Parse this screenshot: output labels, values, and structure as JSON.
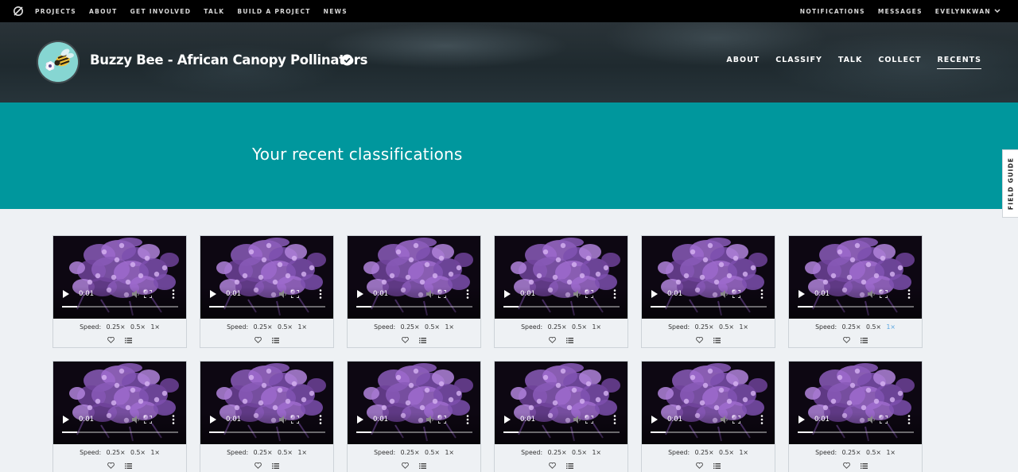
{
  "site_nav": {
    "left_items": [
      "PROJECTS",
      "ABOUT",
      "GET INVOLVED",
      "TALK",
      "BUILD A PROJECT",
      "NEWS"
    ],
    "right_items": [
      "NOTIFICATIONS",
      "MESSAGES"
    ],
    "user": "EVELYNKWAN",
    "logo_icon": "zooniverse-logo-icon"
  },
  "project": {
    "title": "Buzzy Bee - African Canopy Pollinators",
    "verified_icon": "verified-check-icon",
    "nav": [
      {
        "label": "ABOUT",
        "active": false
      },
      {
        "label": "CLASSIFY",
        "active": false
      },
      {
        "label": "TALK",
        "active": false
      },
      {
        "label": "COLLECT",
        "active": false
      },
      {
        "label": "RECENTS",
        "active": true
      }
    ]
  },
  "hero": {
    "title": "Your recent classifications"
  },
  "field_guide": {
    "label": "FIELD GUIDE"
  },
  "colors": {
    "hero_bg": "#00979d",
    "nav_bg": "#000000",
    "page_bg": "#eef1f4",
    "selected_speed": "#5aa6e0"
  },
  "recents": {
    "speed_label": "Speed:",
    "speed_options": [
      "0.25×",
      "0.5×",
      "1×"
    ],
    "items": [
      {
        "time": "0:01",
        "progress": 0.13,
        "selected_speed": ""
      },
      {
        "time": "0:01",
        "progress": 0.13,
        "selected_speed": ""
      },
      {
        "time": "0:01",
        "progress": 0.13,
        "selected_speed": ""
      },
      {
        "time": "0:01",
        "progress": 0.13,
        "selected_speed": ""
      },
      {
        "time": "0:01",
        "progress": 0.13,
        "selected_speed": ""
      },
      {
        "time": "0:01",
        "progress": 0.13,
        "selected_speed": "1×"
      },
      {
        "time": "0:01",
        "progress": 0.13,
        "selected_speed": ""
      },
      {
        "time": "0:01",
        "progress": 0.13,
        "selected_speed": ""
      },
      {
        "time": "0:01",
        "progress": 0.13,
        "selected_speed": ""
      },
      {
        "time": "0:01",
        "progress": 0.13,
        "selected_speed": ""
      },
      {
        "time": "0:01",
        "progress": 0.13,
        "selected_speed": ""
      },
      {
        "time": "0:01",
        "progress": 0.13,
        "selected_speed": ""
      }
    ],
    "item_icons": [
      "play-icon",
      "volume-icon",
      "fullscreen-icon",
      "more-vertical-icon",
      "heart-icon",
      "collections-list-icon"
    ]
  }
}
